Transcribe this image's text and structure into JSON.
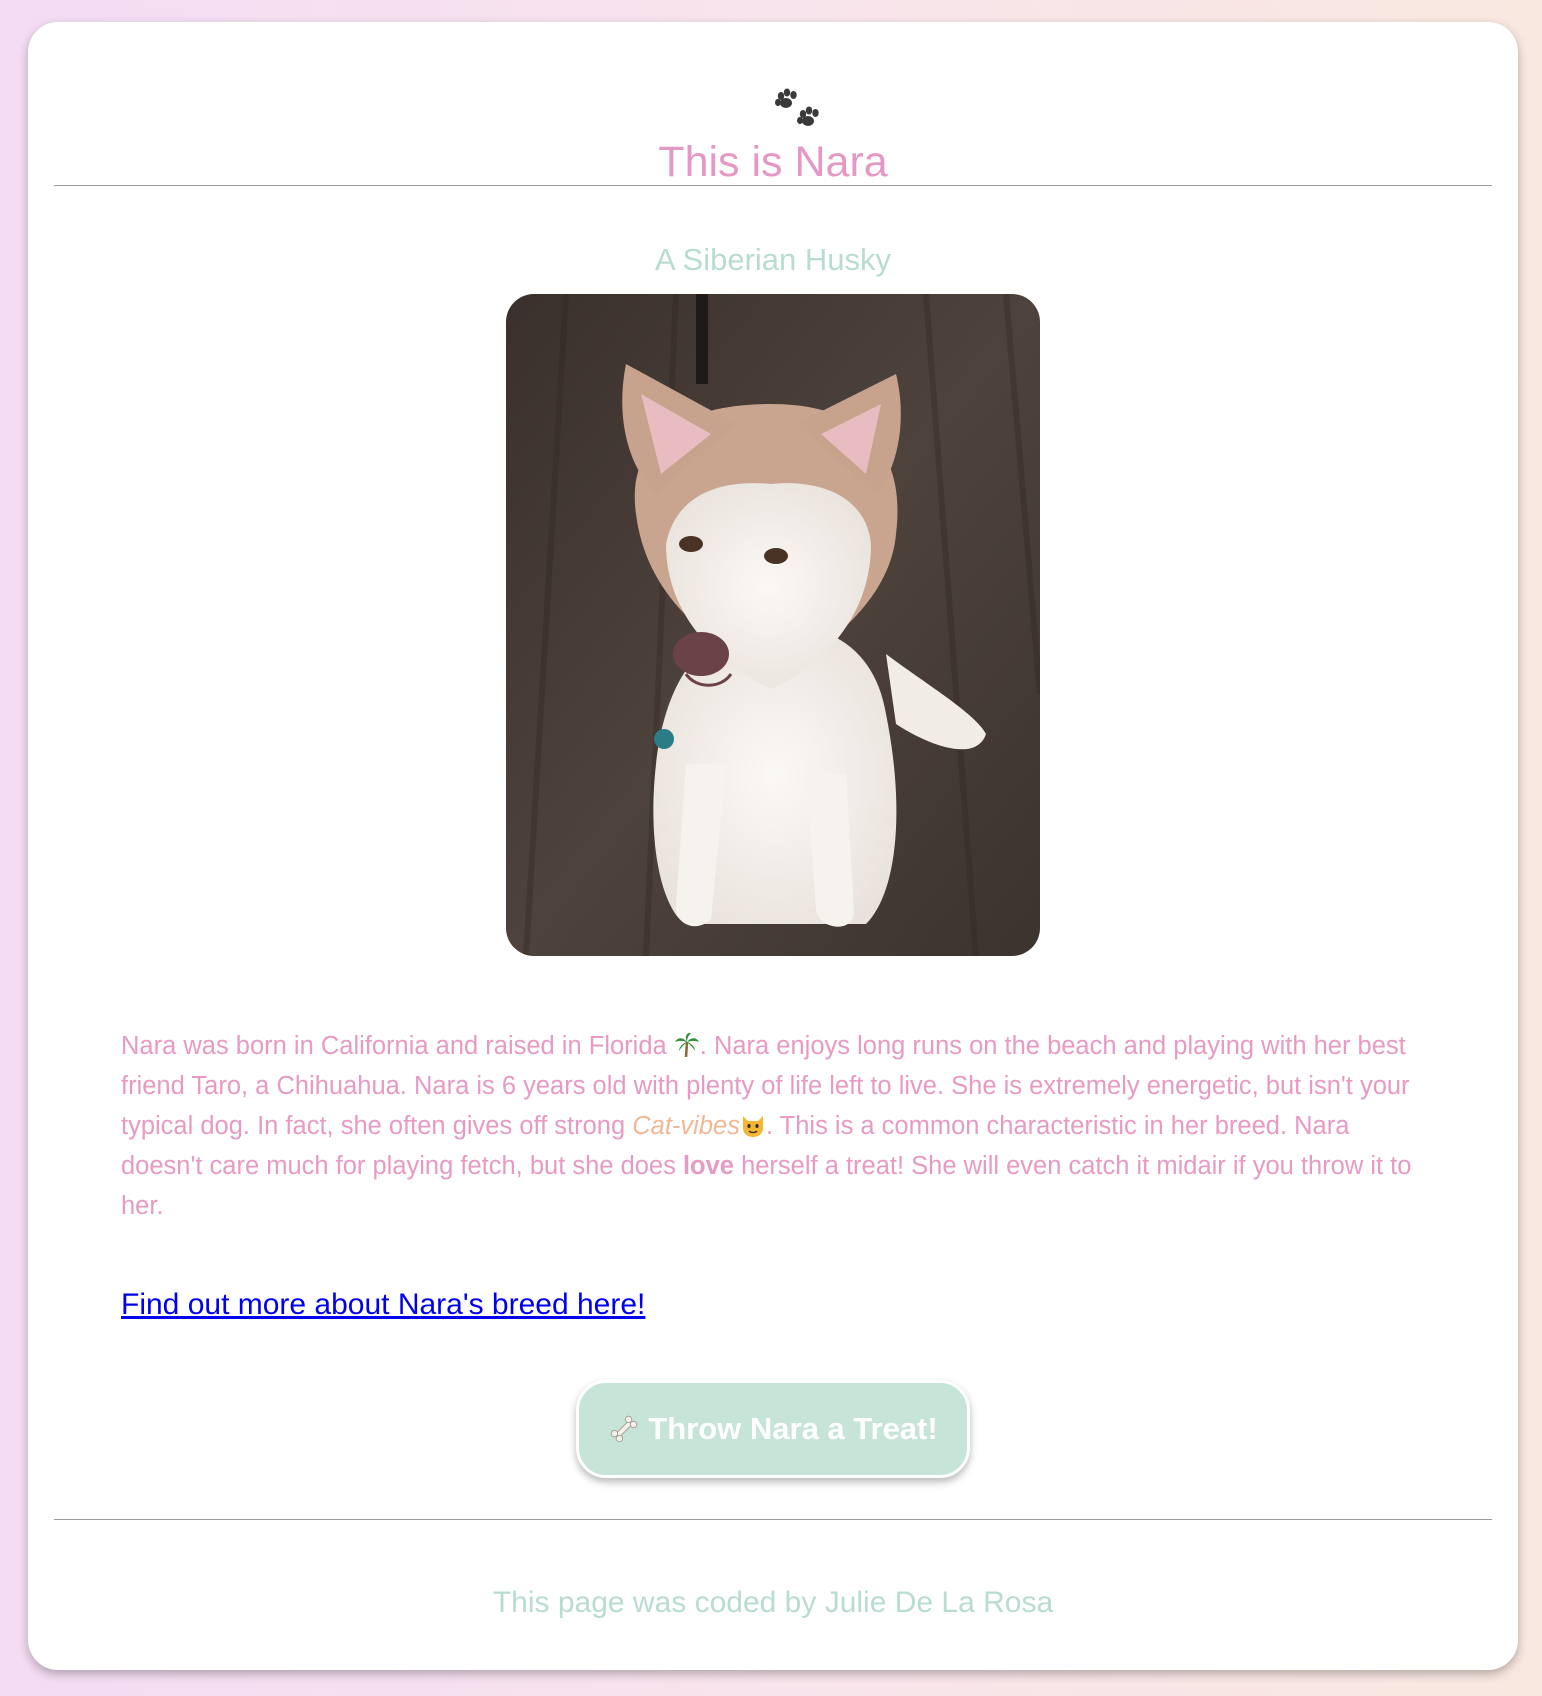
{
  "header": {
    "paw_icon": "paw-prints-icon",
    "title": "This is Nara",
    "subtitle": "A Siberian Husky"
  },
  "photo": {
    "alt": "Nara the Siberian Husky sitting on a wood floor"
  },
  "description": {
    "part1": "Nara was born in California and raised in Florida ",
    "icon_palm": "palm-tree-icon",
    "part2": ". Nara enjoys long runs on the beach and playing with her best friend Taro, a Chihuahua. Nara is 6 years old with plenty of life left to live. She is extremely energetic, but isn't your typical dog. In fact, she often gives off strong ",
    "cat_vibes": "Cat-vibes",
    "icon_cat": "cat-face-icon",
    "part3": ". This is a common characteristic in her breed. Nara doesn't care much for playing fetch, but she does ",
    "love": "love",
    "part4": " herself a treat! She will even catch it midair if you throw it to her."
  },
  "link": {
    "label": "Find out more about Nara's breed here!"
  },
  "button": {
    "icon": "bone-icon",
    "label": "Throw Nara a Treat!"
  },
  "footer": {
    "text": "This page was coded by Julie De La Rosa"
  },
  "colors": {
    "title_pink": "#e598c4",
    "mint": "#b8ddd0",
    "button_mint": "#c6e4d8",
    "cat_vibes_peach": "#f0b896",
    "link_blue": "#0000ee"
  }
}
